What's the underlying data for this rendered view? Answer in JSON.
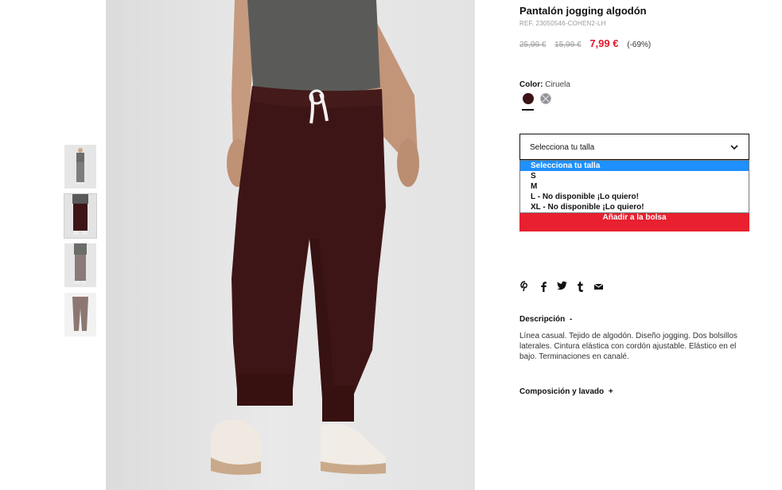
{
  "product": {
    "title": "Pantalón jogging algodón",
    "ref": "REF. 23050546-COHEN2-LH",
    "price_old_1": "25,99 €",
    "price_old_2": "15,99 €",
    "price_now": "7,99 €",
    "discount": "(-69%)"
  },
  "color": {
    "label": "Color:",
    "value": "Ciruela",
    "swatches": [
      {
        "name": "ciruela",
        "hex": "#3b1416"
      },
      {
        "name": "gris",
        "hex": "#8e9096"
      }
    ]
  },
  "size_select": {
    "value": "Selecciona tu talla",
    "options": [
      "Selecciona tu talla",
      "S",
      "M",
      "L - No disponible ¡Lo quiero!",
      "XL - No disponible ¡Lo quiero!"
    ],
    "selected_index": 0
  },
  "add_button": "Añadir a la bolsa",
  "share_icons": [
    "pinterest-icon",
    "facebook-icon",
    "twitter-icon",
    "tumblr-icon",
    "mail-icon"
  ],
  "description": {
    "heading": "Descripción",
    "toggle": "-",
    "text": "Línea casual. Tejido de algodón. Diseño jogging. Dos bolsillos laterales. Cintura elástica con cordón ajustable. Elástico en el bajo. Terminaciones en canalé."
  },
  "composition": {
    "heading": "Composición y lavado",
    "toggle": "+"
  },
  "colors": {
    "accent_red": "#e8202f",
    "price_red": "#e0192d",
    "dropdown_highlight": "#1e90ff",
    "pants": "#3e1516",
    "shirt": "#5a5b58"
  }
}
